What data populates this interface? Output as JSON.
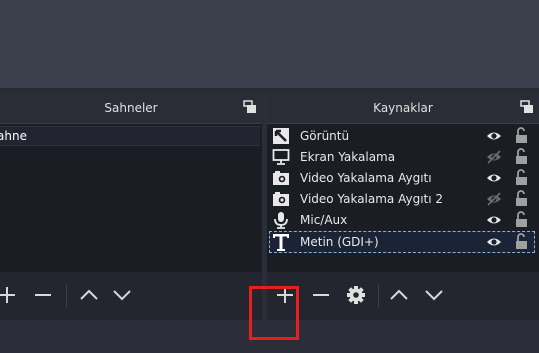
{
  "scenes": {
    "title": "Sahneler",
    "items": [
      {
        "label": "ahne"
      }
    ]
  },
  "sources": {
    "title": "Kaynaklar",
    "items": [
      {
        "label": "Görüntü",
        "icon": "image-icon",
        "visible": true,
        "locked": false
      },
      {
        "label": "Ekran Yakalama",
        "icon": "monitor-icon",
        "visible": false,
        "locked": false
      },
      {
        "label": "Video Yakalama Aygıtı",
        "icon": "camera-icon",
        "visible": true,
        "locked": false
      },
      {
        "label": "Video Yakalama Aygıtı 2",
        "icon": "camera-icon",
        "visible": false,
        "locked": false
      },
      {
        "label": "Mic/Aux",
        "icon": "microphone-icon",
        "visible": true,
        "locked": false
      },
      {
        "label": "Metin (GDI+)",
        "icon": "text-icon",
        "visible": true,
        "locked": false,
        "selected": true
      }
    ]
  },
  "colors": {
    "highlight": "#e81f1f",
    "background": "#2b2e38",
    "list_background": "#1b1d24"
  }
}
